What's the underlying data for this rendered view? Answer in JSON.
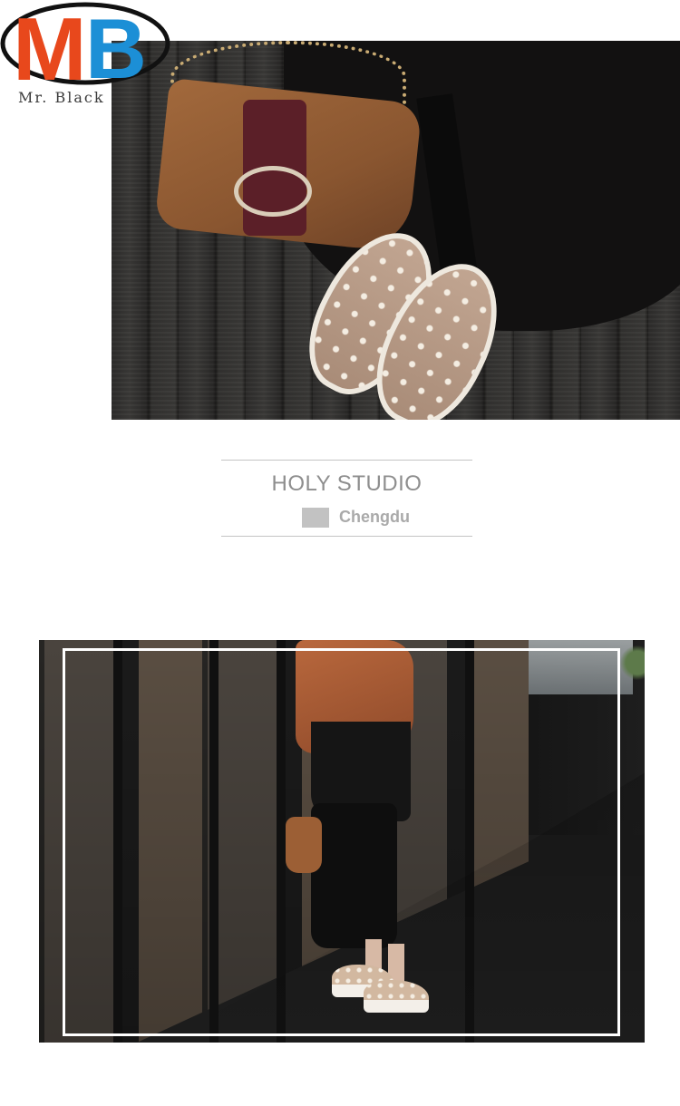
{
  "brand": {
    "monogram_m": "M",
    "monogram_b": "B",
    "caption": "Mr. Black",
    "colors": {
      "m": "#e8481c",
      "b": "#1c8fd6",
      "ring": "#111111"
    }
  },
  "photos": {
    "top": {
      "subject": "product-photo-shoes-and-bag"
    },
    "bottom": {
      "subject": "product-photo-model-on-deck"
    }
  },
  "studio": {
    "title": "HOLY STUDIO",
    "city": "Chengdu"
  }
}
